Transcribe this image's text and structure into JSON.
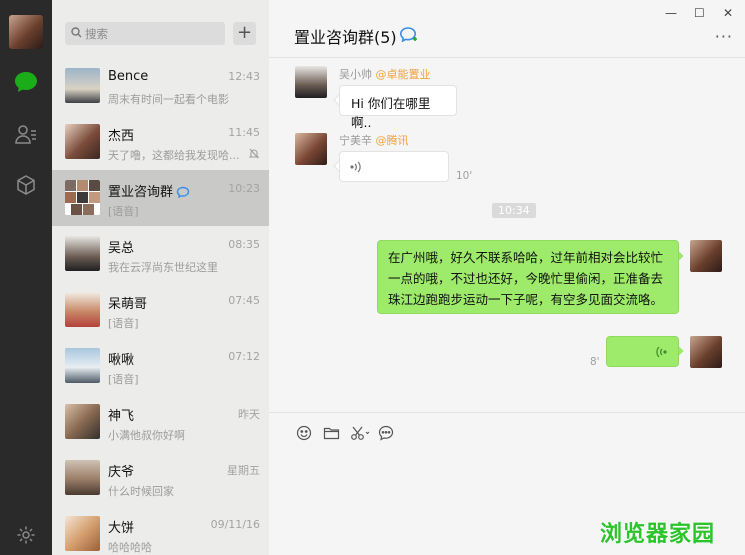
{
  "search": {
    "placeholder": "搜索"
  },
  "conversations": [
    {
      "name": "Bence",
      "time": "12:43",
      "preview": "周末有时间一起看个电影"
    },
    {
      "name": "杰西",
      "time": "11:45",
      "preview": "天了噜，这都给我发现哈..."
    },
    {
      "name": "置业咨询群",
      "time": "10:23",
      "preview": "[语音]"
    },
    {
      "name": "吴总",
      "time": "08:35",
      "preview": "我在云浮尚东世纪这里"
    },
    {
      "name": "呆萌哥",
      "time": "07:45",
      "preview": "[语音]"
    },
    {
      "name": "啾啾",
      "time": "07:12",
      "preview": "[语音]"
    },
    {
      "name": "神飞",
      "time": "昨天",
      "preview": "小满他叔你好啊"
    },
    {
      "name": "庆爷",
      "time": "星期五",
      "preview": "什么时候回家"
    },
    {
      "name": "大饼",
      "time": "09/11/16",
      "preview": "哈哈哈哈"
    }
  ],
  "chat": {
    "title": "置业咨询群(5)",
    "messages": [
      {
        "sender": "吴小帅",
        "org": "@卓能置业",
        "text": "Hi 你们在哪里啊.."
      },
      {
        "sender": "宁美辛",
        "org": "@腾讯",
        "duration": "10'"
      },
      {
        "timestamp": "10:34"
      },
      {
        "text": "在广州哦，好久不联系哈哈，过年前相对会比较忙一点的哦，不过也还好，今晚忙里偷闲，正准备去珠江边跑跑步运动一下子呢，有空多见面交流咯。"
      },
      {
        "duration": "8'"
      }
    ]
  },
  "watermark": "浏览器家园",
  "colors": {
    "accent": "#1aad19",
    "bubble_green": "#9eea6a",
    "org_orange": "#f0a23b",
    "rail": "#2b2a2a"
  }
}
